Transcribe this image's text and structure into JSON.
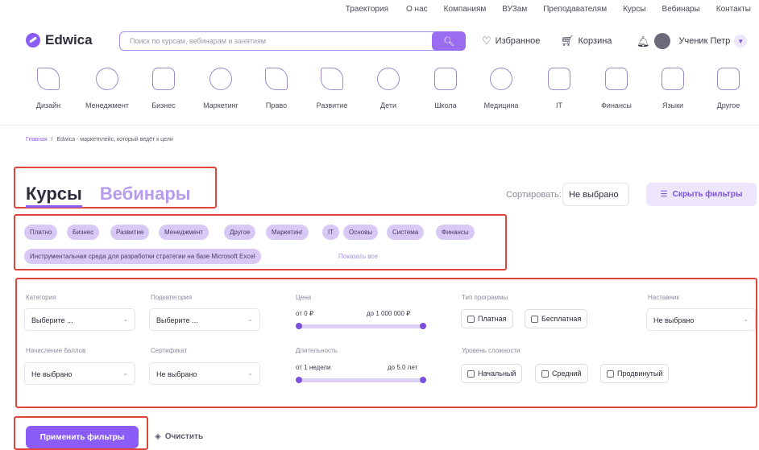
{
  "topnav": [
    "Траектория",
    "О нас",
    "Компаниям",
    "ВУЗам",
    "Преподавателям",
    "Курсы",
    "Вебинары",
    "Контакты"
  ],
  "header": {
    "logo_text": "Edwica",
    "search_placeholder": "Поиск по курсам, вебинарам и занятиям",
    "favorites": "Избранное",
    "cart": "Корзина",
    "user_name": "Ученик Петр"
  },
  "categories": [
    {
      "label": "Дизайн",
      "icon": "design-icon"
    },
    {
      "label": "Менеджмент",
      "icon": "management-icon"
    },
    {
      "label": "Бизнес",
      "icon": "business-icon"
    },
    {
      "label": "Маркетинг",
      "icon": "marketing-icon"
    },
    {
      "label": "Право",
      "icon": "law-icon"
    },
    {
      "label": "Развитие",
      "icon": "development-icon"
    },
    {
      "label": "Дети",
      "icon": "kids-icon"
    },
    {
      "label": "Школа",
      "icon": "school-icon"
    },
    {
      "label": "Медицина",
      "icon": "medicine-icon"
    },
    {
      "label": "IT",
      "icon": "it-icon"
    },
    {
      "label": "Финансы",
      "icon": "finance-icon"
    },
    {
      "label": "Языки",
      "icon": "languages-icon"
    },
    {
      "label": "Другое",
      "icon": "other-icon"
    }
  ],
  "breadcrumb": {
    "home": "Главная",
    "sep": "/",
    "current": "Edwica - маркетплейс, который ведёт к цели"
  },
  "tabs": {
    "courses": "Курсы",
    "webinars": "Вебинары"
  },
  "sort": {
    "label": "Сортировать:",
    "value": "Не выбрано"
  },
  "hide_filters": "Скрыть фильтры",
  "chips": [
    "Платно",
    "Бизнес",
    "Развитие",
    "Менеджмент",
    "Другое",
    "Маркетинг",
    "IT",
    "Основы",
    "Система",
    "Финансы",
    "Инструментальная среда для разработки стратегии на базе Microsoft Excel"
  ],
  "show_all": "Показать все",
  "filters": {
    "category": {
      "label": "Категория",
      "value": "Выберите ..."
    },
    "subcategory": {
      "label": "Подкатегория",
      "value": "Выберите ..."
    },
    "price": {
      "label": "Цена",
      "min": "от 0 ₽",
      "max": "до 1 000 000 ₽"
    },
    "program_type": {
      "label": "Тип программы",
      "options": [
        "Платная",
        "Бесплатная"
      ]
    },
    "mentor": {
      "label": "Наставник",
      "value": "Не выбрано"
    },
    "points": {
      "label": "Начисление баллов",
      "value": "Не выбрано"
    },
    "certificate": {
      "label": "Сертификат",
      "value": "Не выбрано"
    },
    "duration": {
      "label": "Длительность",
      "min": "от 1 недели",
      "max": "до 5.0 лет"
    },
    "difficulty": {
      "label": "Уровень сложности",
      "options": [
        "Начальный",
        "Средний",
        "Продвинутый"
      ]
    }
  },
  "apply_button": "Применить фильтры",
  "clear_button": "Очистить",
  "colors": {
    "accent": "#8b5cf6",
    "chip_bg": "#d8c8f6",
    "highlight_border": "#e0453a"
  }
}
